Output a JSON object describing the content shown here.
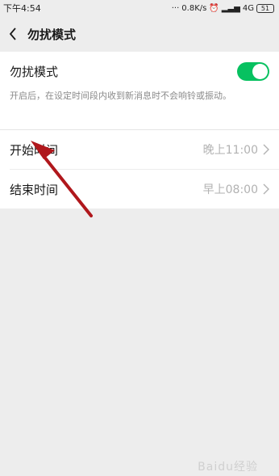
{
  "status_bar": {
    "time": "下午4:54",
    "network_speed": "0.8K/s",
    "network": "4G",
    "battery": "51"
  },
  "header": {
    "title": "勿扰模式",
    "back_icon": "chevron-left-icon"
  },
  "dnd": {
    "label": "勿扰模式",
    "description": "开启后，在设定时间段内收到新消息时不会响铃或振动。",
    "enabled": true,
    "toggle_color": "#07c160"
  },
  "schedule": [
    {
      "label": "开始时间",
      "value": "晚上11:00"
    },
    {
      "label": "结束时间",
      "value": "早上08:00"
    }
  ],
  "watermark": "Baidu经验"
}
